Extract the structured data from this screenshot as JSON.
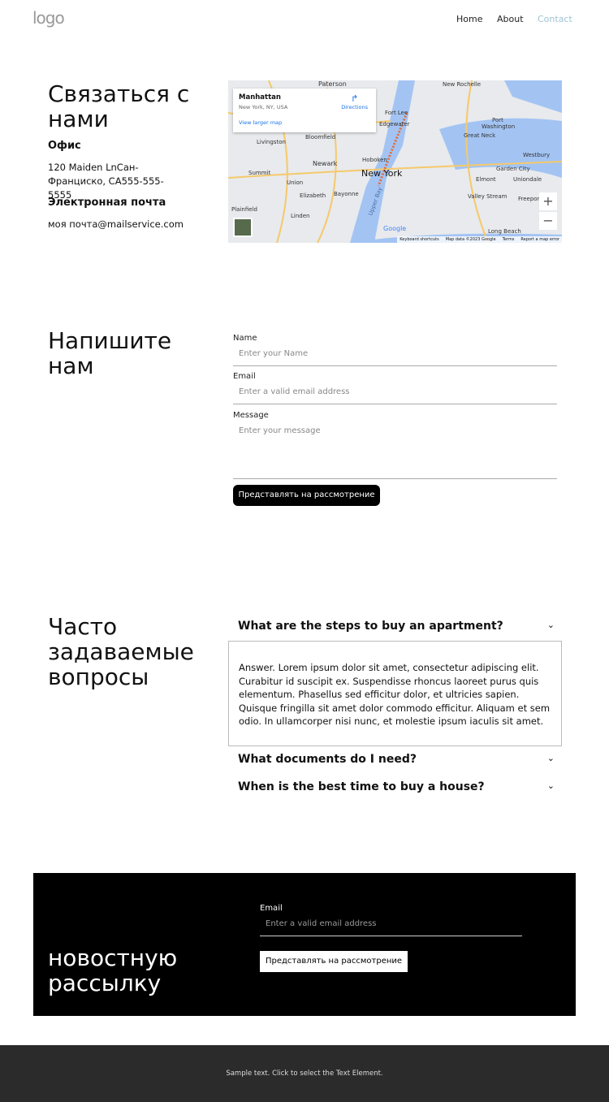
{
  "header": {
    "logo": "logo",
    "nav": [
      "Home",
      "About",
      "Contact"
    ],
    "active_color": "#9ec5d4"
  },
  "contact": {
    "title": "Связаться с нами",
    "office_label": "Офис",
    "office_address": "120 Maiden LnСан-Франциско, CA555-555-5555",
    "email_label": "Электронная почта",
    "email": "моя почта@mailservice.com"
  },
  "map": {
    "place": "Manhattan",
    "place_sub": "New York, NY, USA",
    "directions": "Directions",
    "view_larger": "View larger map",
    "city": "New York",
    "labels": [
      "Paterson",
      "New Rochelle",
      "Fort Lee",
      "Edgewater",
      "Port Washington",
      "Great Neck",
      "Bloomfield",
      "Livingston",
      "Newark",
      "Hoboken",
      "Westbury",
      "Garden City",
      "Summit",
      "Union",
      "Elmont",
      "Uniondale",
      "Elizabeth",
      "Bayonne",
      "Valley Stream",
      "Freeport",
      "Plainfield",
      "Linden",
      "Long Beach",
      "Upper Bay"
    ],
    "footer": [
      "Keyboard shortcuts",
      "Map data ©2023 Google",
      "Terms",
      "Report a map error"
    ],
    "zoom_in": "+",
    "zoom_out": "−",
    "google": "Google"
  },
  "form": {
    "title": "Напишите нам",
    "name_label": "Name",
    "name_placeholder": "Enter your Name",
    "email_label": "Email",
    "email_placeholder": "Enter a valid email address",
    "message_label": "Message",
    "message_placeholder": "Enter your message",
    "submit": "Представлять на рассмотрение"
  },
  "faq": {
    "title": "Часто задаваемые вопросы",
    "items": [
      {
        "q": "What are the steps to buy an apartment?",
        "a": "Answer. Lorem ipsum dolor sit amet, consectetur adipiscing elit. Curabitur id suscipit ex. Suspendisse rhoncus laoreet purus quis elementum. Phasellus sed efficitur dolor, et ultricies sapien. Quisque fringilla sit amet dolor commodo efficitur. Aliquam et sem odio. In ullamcorper nisi nunc, et molestie ipsum iaculis sit amet."
      },
      {
        "q": "What documents do I need?"
      },
      {
        "q": "When is the best time to buy a house?"
      }
    ]
  },
  "newsletter": {
    "title": "новостную рассылку",
    "email_label": "Email",
    "email_placeholder": "Enter a valid email address",
    "submit": "Представлять на рассмотрение"
  },
  "footer": {
    "text": "Sample text. Click to select the Text Element."
  }
}
